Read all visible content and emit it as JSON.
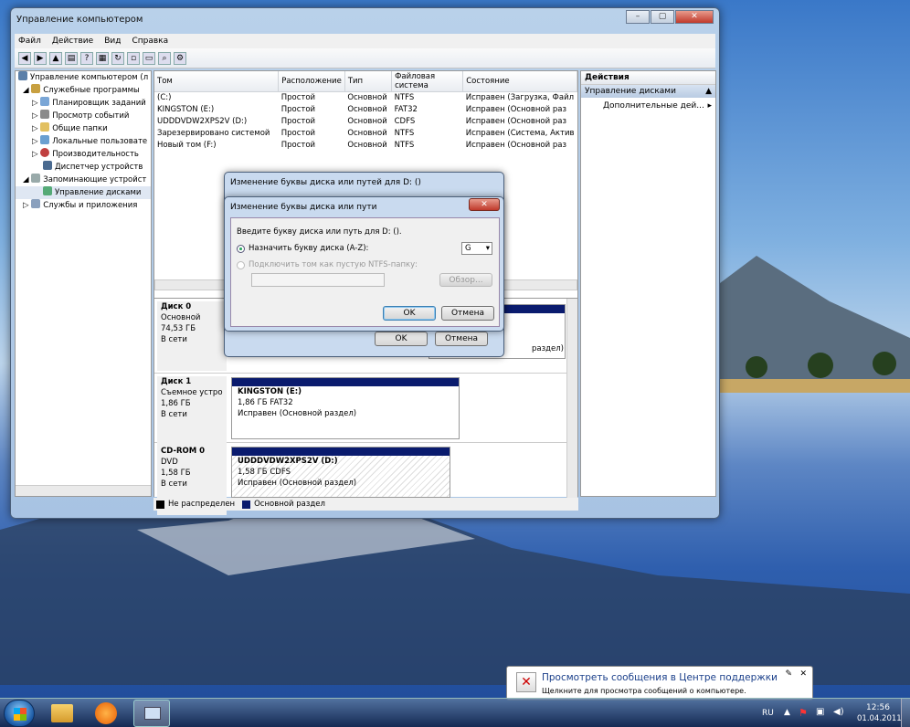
{
  "window": {
    "title": "Управление компьютером",
    "controls": [
      "–",
      "▢",
      "✕"
    ]
  },
  "menu": [
    "Файл",
    "Действие",
    "Вид",
    "Справка"
  ],
  "tree": [
    {
      "label": "Управление компьютером (л",
      "level": 0
    },
    {
      "label": "Служебные программы",
      "level": 1
    },
    {
      "label": "Планировщик заданий",
      "level": 2
    },
    {
      "label": "Просмотр событий",
      "level": 2
    },
    {
      "label": "Общие папки",
      "level": 2
    },
    {
      "label": "Локальные пользовате",
      "level": 2
    },
    {
      "label": "Производительность",
      "level": 2
    },
    {
      "label": "Диспетчер устройств",
      "level": 2
    },
    {
      "label": "Запоминающие устройст",
      "level": 1
    },
    {
      "label": "Управление дисками",
      "level": 2
    },
    {
      "label": "Службы и приложения",
      "level": 1
    }
  ],
  "volumes": {
    "headers": [
      "Том",
      "Расположение",
      "Тип",
      "Файловая система",
      "Состояние"
    ],
    "rows": [
      [
        "(C:)",
        "Простой",
        "Основной",
        "NTFS",
        "Исправен (Загрузка, Файл"
      ],
      [
        "KINGSTON (E:)",
        "Простой",
        "Основной",
        "FAT32",
        "Исправен (Основной раз"
      ],
      [
        "UDDDVDW2XPS2V (D:)",
        "Простой",
        "Основной",
        "CDFS",
        "Исправен (Основной раз"
      ],
      [
        "Зарезервировано системой",
        "Простой",
        "Основной",
        "NTFS",
        "Исправен (Система, Актив"
      ],
      [
        "Новый том (F:)",
        "Простой",
        "Основной",
        "NTFS",
        "Исправен (Основной раз"
      ]
    ]
  },
  "disks": [
    {
      "name": "Диск 0",
      "lines": [
        "Основной",
        "74,53 ГБ",
        "В сети"
      ],
      "part": {
        "title": "",
        "l1": "",
        "l2": "раздел)"
      }
    },
    {
      "name": "Диск 1",
      "lines": [
        "Съемное устро",
        "1,86 ГБ",
        "В сети"
      ],
      "part": {
        "title": "KINGSTON  (E:)",
        "l1": "1,86 ГБ FAT32",
        "l2": "Исправен (Основной раздел)"
      }
    },
    {
      "name": "CD-ROM 0",
      "lines": [
        "DVD",
        "1,58 ГБ",
        "В сети"
      ],
      "part": {
        "title": "UDDDVDW2XPS2V  (D:)",
        "l1": "1,58 ГБ CDFS",
        "l2": "Исправен (Основной раздел)"
      }
    }
  ],
  "legend": {
    "unallocated": "Не распределен",
    "primary": "Основной раздел"
  },
  "actions": {
    "header": "Действия",
    "section": "Управление дисками",
    "more": "Дополнительные дей..."
  },
  "dialog_outer": {
    "title": "Изменение буквы диска или путей для D: ()",
    "ok": "OK",
    "cancel": "Отмена"
  },
  "dialog_inner": {
    "title": "Изменение буквы диска или пути",
    "prompt": "Введите букву диска или путь для D: ().",
    "radio_assign": "Назначить букву диска (A-Z):",
    "drive_letter": "G",
    "radio_mount": "Подключить том как пустую NTFS-папку:",
    "browse": "Обзор...",
    "ok": "OK",
    "cancel": "Отмена"
  },
  "notification": {
    "title": "Просмотреть сообщения в Центре поддержки",
    "text": "Щелкните для просмотра сообщений о компьютере."
  },
  "taskbar": {
    "lang": "RU",
    "time": "12:56",
    "date": "01.04.2011"
  },
  "colors": {
    "primary_partition": "#0a1b6e",
    "unallocated": "#000000"
  }
}
